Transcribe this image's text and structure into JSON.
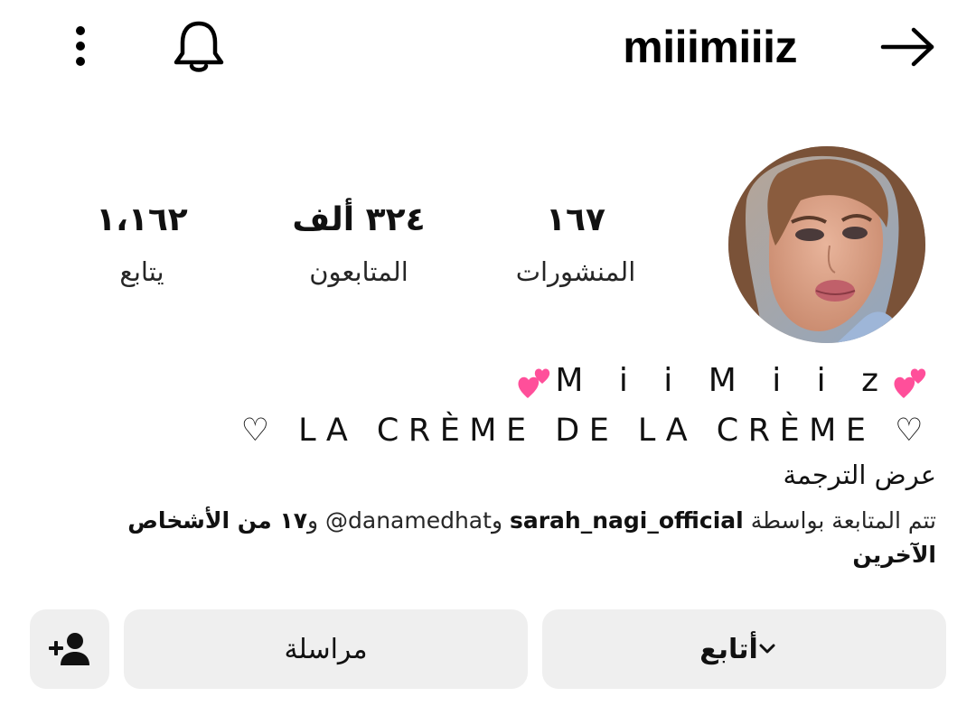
{
  "header": {
    "username": "miiimiiiz",
    "icons": {
      "more": "more-vertical-icon",
      "notifications": "bell-icon",
      "back": "arrow-right-icon"
    }
  },
  "profile": {
    "avatar": "profile-photo",
    "stats": {
      "posts": {
        "value": "١٦٧",
        "label": "المنشورات"
      },
      "followers": {
        "value": "٣٢٤ ألف",
        "label": "المتابعون"
      },
      "following": {
        "value": "١،١٦٢",
        "label": "يتابع"
      }
    }
  },
  "bio": {
    "display_name": "M i i M i i z",
    "tagline": "♡ LA CRÈME DE LA CRÈME ♡",
    "see_translation": "عرض الترجمة",
    "followed_by": {
      "prefix": "تتم المتابعة بواسطة",
      "user1": "sarah_nagi_official",
      "conj": "و",
      "user2": "danamedhat@",
      "conj2": "و",
      "others": "١٧ من الأشخاص الآخرين"
    }
  },
  "actions": {
    "follow": "أتابع",
    "message": "مراسلة",
    "add_user_icon": "add-user-icon"
  },
  "colors": {
    "button_bg": "#efefef",
    "text": "#111111",
    "heart_pink": "#ff4f9a"
  }
}
